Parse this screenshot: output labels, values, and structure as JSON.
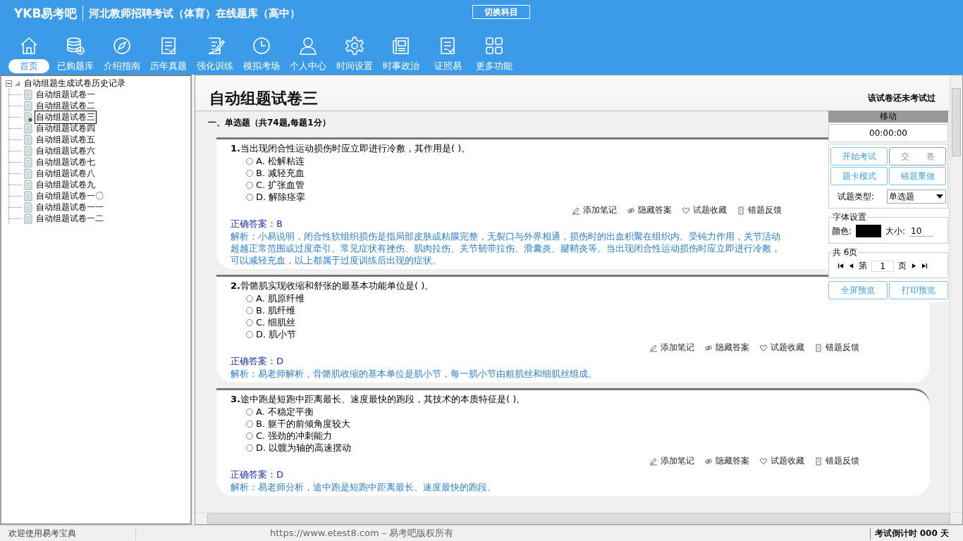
{
  "header": {
    "logo": "YKB易考吧",
    "title": "河北教师招聘考试（体育）在线题库（高中）",
    "switch_button": "切换科目"
  },
  "nav": [
    {
      "label": "首页",
      "selected": true
    },
    {
      "label": "已购题库",
      "selected": false
    },
    {
      "label": "介绍指南",
      "selected": false
    },
    {
      "label": "历年真题",
      "selected": false
    },
    {
      "label": "强化训练",
      "selected": false
    },
    {
      "label": "模拟考场",
      "selected": false
    },
    {
      "label": "个人中心",
      "selected": false
    },
    {
      "label": "时间设置",
      "selected": false
    },
    {
      "label": "时事政治",
      "selected": false
    },
    {
      "label": "证照易",
      "selected": false
    },
    {
      "label": "更多功能",
      "selected": false
    }
  ],
  "tree": {
    "label": "自动组题生成试卷历史记录",
    "expanded": true,
    "children": [
      {
        "label": "自动组题试卷一",
        "selected": false
      },
      {
        "label": "自动组题试卷二",
        "selected": false
      },
      {
        "label": "自动组题试卷三",
        "selected": true
      },
      {
        "label": "自动组题试卷四",
        "selected": false
      },
      {
        "label": "自动组题试卷五",
        "selected": false
      },
      {
        "label": "自动组题试卷六",
        "selected": false
      },
      {
        "label": "自动组题试卷七",
        "selected": false
      },
      {
        "label": "自动组题试卷八",
        "selected": false
      },
      {
        "label": "自动组题试卷九",
        "selected": false
      },
      {
        "label": "自动组题试卷一〇",
        "selected": false
      },
      {
        "label": "自动组题试卷一一",
        "selected": false
      },
      {
        "label": "自动组题试卷一二",
        "selected": false
      }
    ]
  },
  "paper": {
    "title": "自动组题试卷三",
    "status": "该试卷还未考试过",
    "section": "一、单选题（共74题,每题1分）",
    "questions": [
      {
        "number": "1.",
        "stem": "当出现闭合性运动损伤时应立即进行冷敷，其作用是( )。",
        "options": [
          {
            "letter": "A.",
            "text": "松解粘连",
            "selected": false
          },
          {
            "letter": "B.",
            "text": "减轻充血",
            "selected": false
          },
          {
            "letter": "C.",
            "text": "扩张血管",
            "selected": false
          },
          {
            "letter": "D.",
            "text": "解除痉挛",
            "selected": false
          }
        ],
        "actions": [
          "添加笔记",
          "隐藏答案",
          "试题收藏",
          "错题反馈"
        ],
        "answer_label": "正确答案：",
        "answer": "B",
        "analysis": "解析：小易说明，闭合性软组织损伤是指局部皮肤或粘膜完整，无裂口与外界相通，损伤时的出血积聚在组织内。受钝力作用，关节活动超越正常范围或过度牵引。常见症状有挫伤、肌肉拉伤、关节韧带拉伤、滑囊炎、腱鞘炎等。当出现闭合性运动损伤时应立即进行冷敷，可以减轻充血，以上都属于过度训练后出现的症状。"
      },
      {
        "number": "2.",
        "stem": "骨骼肌实现收缩和舒张的最基本功能单位是( )。",
        "options": [
          {
            "letter": "A.",
            "text": "肌原纤维",
            "selected": false
          },
          {
            "letter": "B.",
            "text": "肌纤维",
            "selected": false
          },
          {
            "letter": "C.",
            "text": "细肌丝",
            "selected": false
          },
          {
            "letter": "D.",
            "text": "肌小节",
            "selected": false
          }
        ],
        "actions": [
          "添加笔记",
          "隐藏答案",
          "试题收藏",
          "错题反馈"
        ],
        "answer_label": "正确答案：",
        "answer": "D",
        "analysis": "解析：易老师解析，骨骼肌收缩的基本单位是肌小节，每一肌小节由粗肌丝和细肌丝组成。"
      },
      {
        "number": "3.",
        "stem": "途中跑是短跑中距离最长、速度最快的跑段，其技术的本质特征是( )。",
        "options": [
          {
            "letter": "A.",
            "text": "不稳定平衡",
            "selected": false
          },
          {
            "letter": "B.",
            "text": "躯干的前倾角度较大",
            "selected": false
          },
          {
            "letter": "C.",
            "text": "强劲的冲刺能力",
            "selected": false
          },
          {
            "letter": "D.",
            "text": "以髋为轴的高速摆动",
            "selected": false
          }
        ],
        "actions": [
          "添加笔记",
          "隐藏答案",
          "试题收藏",
          "错题反馈"
        ],
        "answer_label": "正确答案：",
        "answer": "D",
        "analysis": "解析：易老师分析，途中跑是短跑中距离最长、速度最快的跑段。"
      }
    ]
  },
  "panel": {
    "move_label": "移动",
    "timer": "00:00:00",
    "buttons": [
      {
        "label": "开始考试",
        "disabled": false
      },
      {
        "label": "交　　卷",
        "disabled": true
      },
      {
        "label": "题卡模式",
        "disabled": false
      },
      {
        "label": "错题重做",
        "disabled": false
      }
    ],
    "type_label": "试题类型:",
    "type_value": "单选题",
    "font_group": "字体设置",
    "color_label": "颜色:",
    "color": "#000000",
    "size_label": "大小:",
    "size": "10",
    "pages_label": "共 6页",
    "page_prefix": "第",
    "page": "1",
    "page_suffix": "页",
    "preview_buttons": [
      {
        "label": "全屏预览",
        "disabled": false
      },
      {
        "label": "打印预览",
        "disabled": false
      }
    ]
  },
  "status_bar": {
    "welcome": "欢迎使用易考宝典",
    "copyright": "https://www.etest8.com – 易考吧版权所有",
    "countdown": "考试倒计时 000 天"
  }
}
